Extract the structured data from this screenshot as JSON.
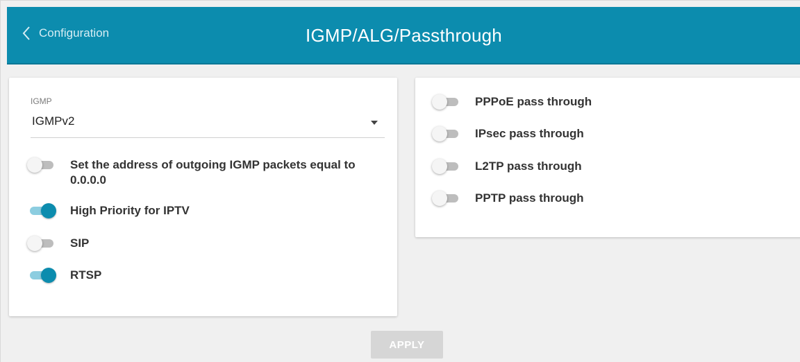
{
  "header": {
    "back_label": "Configuration",
    "title": "IGMP/ALG/Passthrough",
    "color": "#0c8cae"
  },
  "left_card": {
    "igmp": {
      "label": "IGMP",
      "value": "IGMPv2"
    },
    "toggles": [
      {
        "label": "Set the address of outgoing IGMP packets equal to 0.0.0.0",
        "on": false
      },
      {
        "label": "High Priority for IPTV",
        "on": true
      },
      {
        "label": "SIP",
        "on": false
      },
      {
        "label": "RTSP",
        "on": true
      }
    ]
  },
  "right_card": {
    "toggles": [
      {
        "label": "PPPoE pass through",
        "on": false
      },
      {
        "label": "IPsec pass through",
        "on": false
      },
      {
        "label": "L2TP pass through",
        "on": false
      },
      {
        "label": "PPTP pass through",
        "on": false
      }
    ]
  },
  "apply_label": "APPLY",
  "accent": "#0c8cae"
}
